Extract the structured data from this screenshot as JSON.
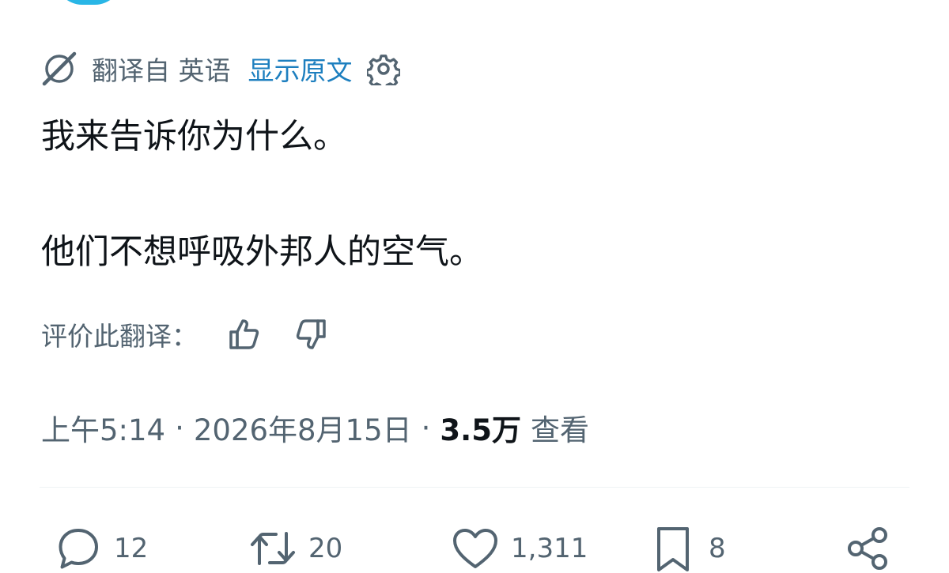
{
  "translation": {
    "icon": "translate-globe-icon",
    "label": "翻译自 英语",
    "show_original": "显示原文",
    "settings_icon": "gear-icon",
    "link_color": "#1d7fbf"
  },
  "tweet": {
    "line1": "我来告诉你为什么。",
    "line2": "他们不想呼吸外邦人的空气。"
  },
  "rating": {
    "label": "评价此翻译：",
    "up_icon": "thumbs-up-icon",
    "down_icon": "thumbs-down-icon"
  },
  "meta": {
    "time": "上午5:14",
    "separator": "·",
    "date": "2026年8月15日",
    "views_count": "3.5万",
    "views_label": "查看"
  },
  "actions": {
    "reply": {
      "icon": "reply-icon",
      "count": "12"
    },
    "retweet": {
      "icon": "retweet-icon",
      "count": "20"
    },
    "like": {
      "icon": "heart-icon",
      "count": "1,311"
    },
    "bookmark": {
      "icon": "bookmark-icon",
      "count": "8"
    },
    "share": {
      "icon": "share-icon"
    }
  },
  "colors": {
    "text_primary": "#0f1419",
    "text_secondary": "#536471",
    "avatar": "#29b6e6"
  }
}
